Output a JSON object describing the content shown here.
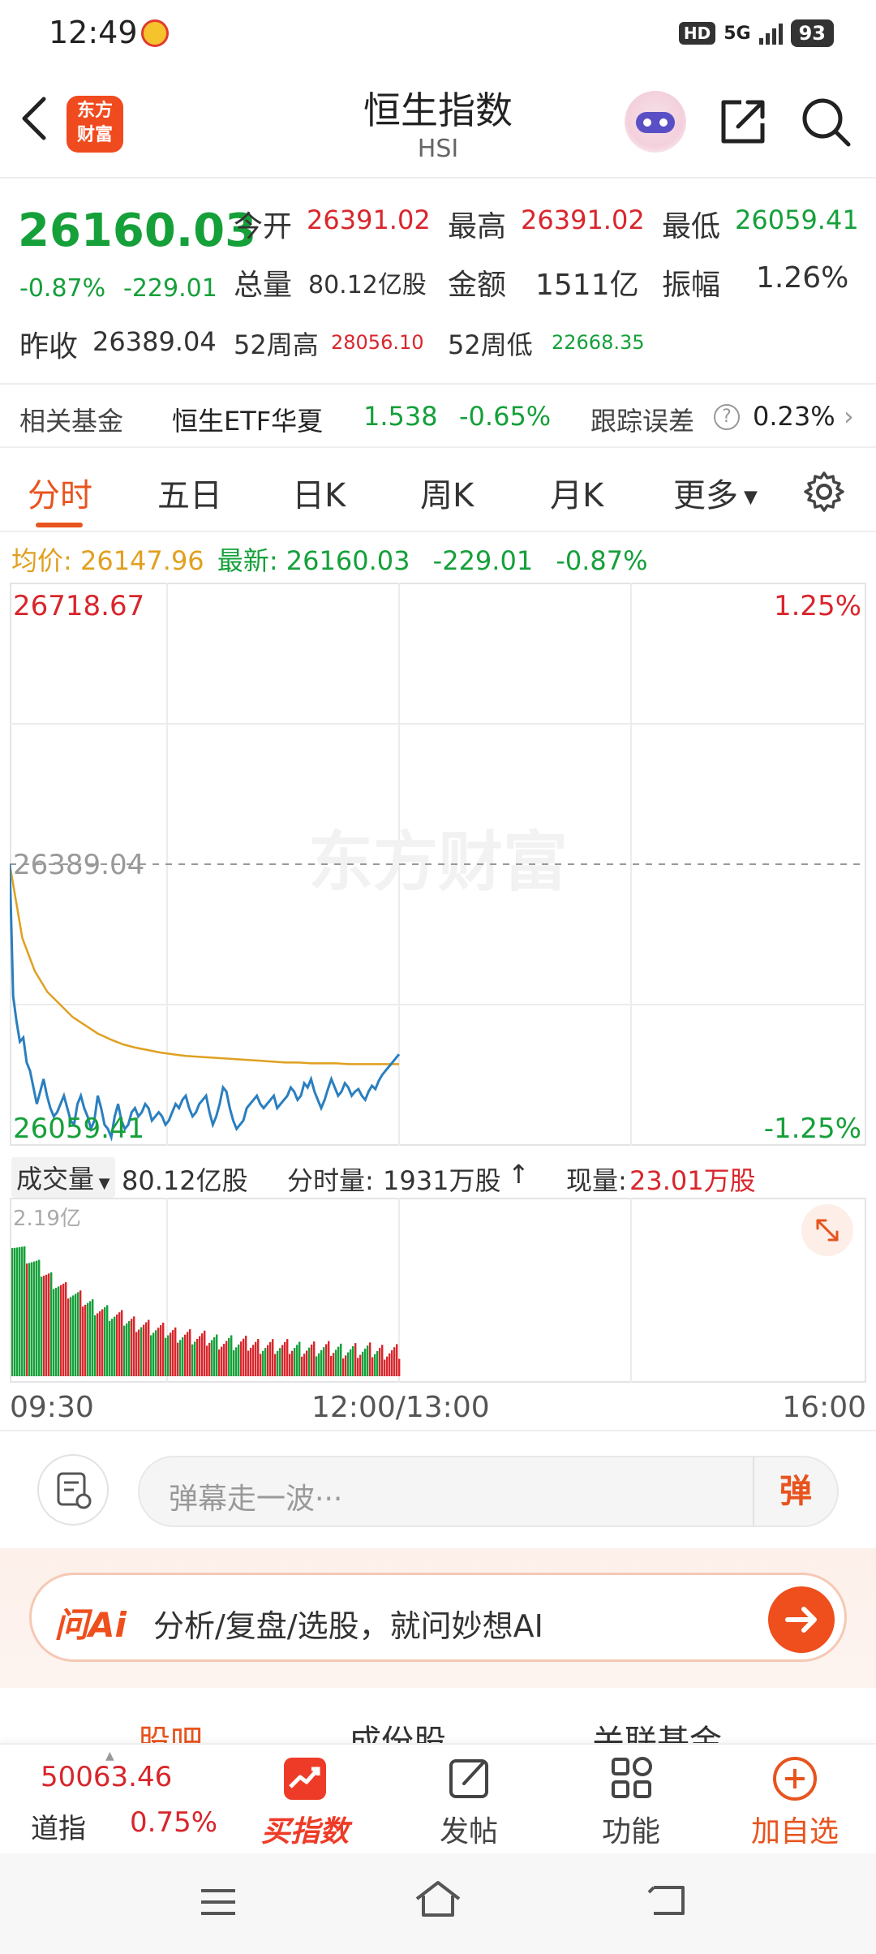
{
  "status_bar": {
    "time": "12:49",
    "network": "5G",
    "hd": "HD",
    "battery": "93"
  },
  "header": {
    "title": "恒生指数",
    "subtitle": "HSI",
    "logo_text_line1": "东方",
    "logo_text_line2": "财富"
  },
  "quote": {
    "price": "26160.03",
    "change_pct": "-0.87%",
    "change_val": "-229.01",
    "open_label": "今开",
    "open": "26391.02",
    "high_label": "最高",
    "high": "26391.02",
    "low_label": "最低",
    "low": "26059.41",
    "volume_label": "总量",
    "volume": "80.12亿股",
    "amount_label": "金额",
    "amount": "1511亿",
    "amplitude_label": "振幅",
    "amplitude": "1.26%",
    "prev_close_label": "昨收",
    "prev_close": "26389.04",
    "wk52_high_label": "52周高",
    "wk52_high": "28056.10",
    "wk52_low_label": "52周低",
    "wk52_low": "22668.35"
  },
  "related_fund": {
    "label": "相关基金",
    "name": "恒生ETF华夏",
    "price": "1.538",
    "change": "-0.65%",
    "tracking_label": "跟踪误差",
    "tracking_value": "0.23%"
  },
  "tabs": [
    {
      "label": "分时",
      "active": true
    },
    {
      "label": "五日"
    },
    {
      "label": "日K"
    },
    {
      "label": "周K"
    },
    {
      "label": "月K"
    },
    {
      "label": "更多"
    }
  ],
  "summary": {
    "avg_label": "均价:",
    "avg_value": "26147.96",
    "latest_label": "最新:",
    "latest_value": "26160.03",
    "change_val": "-229.01",
    "change_pct": "-0.87%"
  },
  "chart_labels": {
    "top_price": "26718.67",
    "mid_price": "26389.04",
    "bottom_price": "26059.41",
    "top_pct": "1.25%",
    "bottom_pct": "-1.25%",
    "watermark": "东方财富"
  },
  "chart_data": {
    "type": "line",
    "ylim": [
      26059.41,
      26718.67
    ],
    "reference": 26389.04,
    "series": [
      {
        "values": [
          26389,
          26230,
          26200,
          26175,
          26180,
          26150,
          26140,
          26120,
          26100,
          26115,
          26130,
          26110,
          26095,
          26085,
          26090,
          26100,
          26110,
          26095,
          26080,
          26075,
          26100,
          26110,
          26095,
          26085,
          26070,
          26080,
          26110,
          26095,
          26075,
          26070,
          26060,
          26085,
          26100,
          26080,
          26070,
          26075,
          26090,
          26095,
          26085,
          26090,
          26100,
          26095,
          26080,
          26085,
          26090,
          26085,
          26075,
          26080,
          26090,
          26100,
          26095,
          26105,
          26110,
          26095,
          26085,
          26090,
          26100,
          26105,
          26110,
          26090,
          26075,
          26085,
          26100,
          26120,
          26115,
          26095,
          26080,
          26070,
          26075,
          26080,
          26095,
          26100,
          26105,
          26110,
          26100,
          26095,
          26100,
          26105,
          26110,
          26095,
          26100,
          26105,
          26110,
          26120,
          26115,
          26105,
          26110,
          26125,
          26120,
          26130,
          26115,
          26105,
          26095,
          26105,
          26118,
          26130,
          26120,
          26110,
          26115,
          26125,
          26120,
          26110,
          26115,
          26118,
          26110,
          26105,
          26115,
          26122,
          26118,
          26128,
          26135,
          26140,
          26145,
          26150,
          26155,
          26160
        ]
      },
      {
        "values": [
          26389,
          26300,
          26260,
          26235,
          26220,
          26205,
          26195,
          26185,
          26178,
          26172,
          26168,
          26165,
          26162,
          26160,
          26158,
          26157,
          26156,
          26155,
          26154,
          26153,
          26152,
          26151,
          26150,
          26150,
          26149,
          26149,
          26149,
          26148,
          26148,
          26148,
          26148,
          26148
        ]
      }
    ]
  },
  "volume": {
    "label": "成交量",
    "total": "80.12亿股",
    "period_label": "分时量:",
    "period_value": "1931万股",
    "current_label": "现量:",
    "current_value": "23.01万股",
    "max_label": "2.19亿"
  },
  "time_axis": {
    "start": "09:30",
    "mid": "12:00/13:00",
    "end": "16:00"
  },
  "comment": {
    "placeholder": "弹幕走一波···",
    "toggle": "弹"
  },
  "ai": {
    "logo": "问Ai",
    "prompt": "分析/复盘/选股，就问妙想AI"
  },
  "sub_tabs": [
    "股吧",
    "成份股",
    "关联基金"
  ],
  "bottom_nav": {
    "index_value": "50063.46",
    "index_name": "道指",
    "index_pct": "0.75%",
    "buy_index": "买指数",
    "post": "发帖",
    "functions": "功能",
    "add_watchlist": "加自选"
  },
  "colors": {
    "up": "#d8262c",
    "down": "#15a03a",
    "accent": "#e8541e",
    "line": "#2a7fbf",
    "avg": "#e0a020"
  }
}
